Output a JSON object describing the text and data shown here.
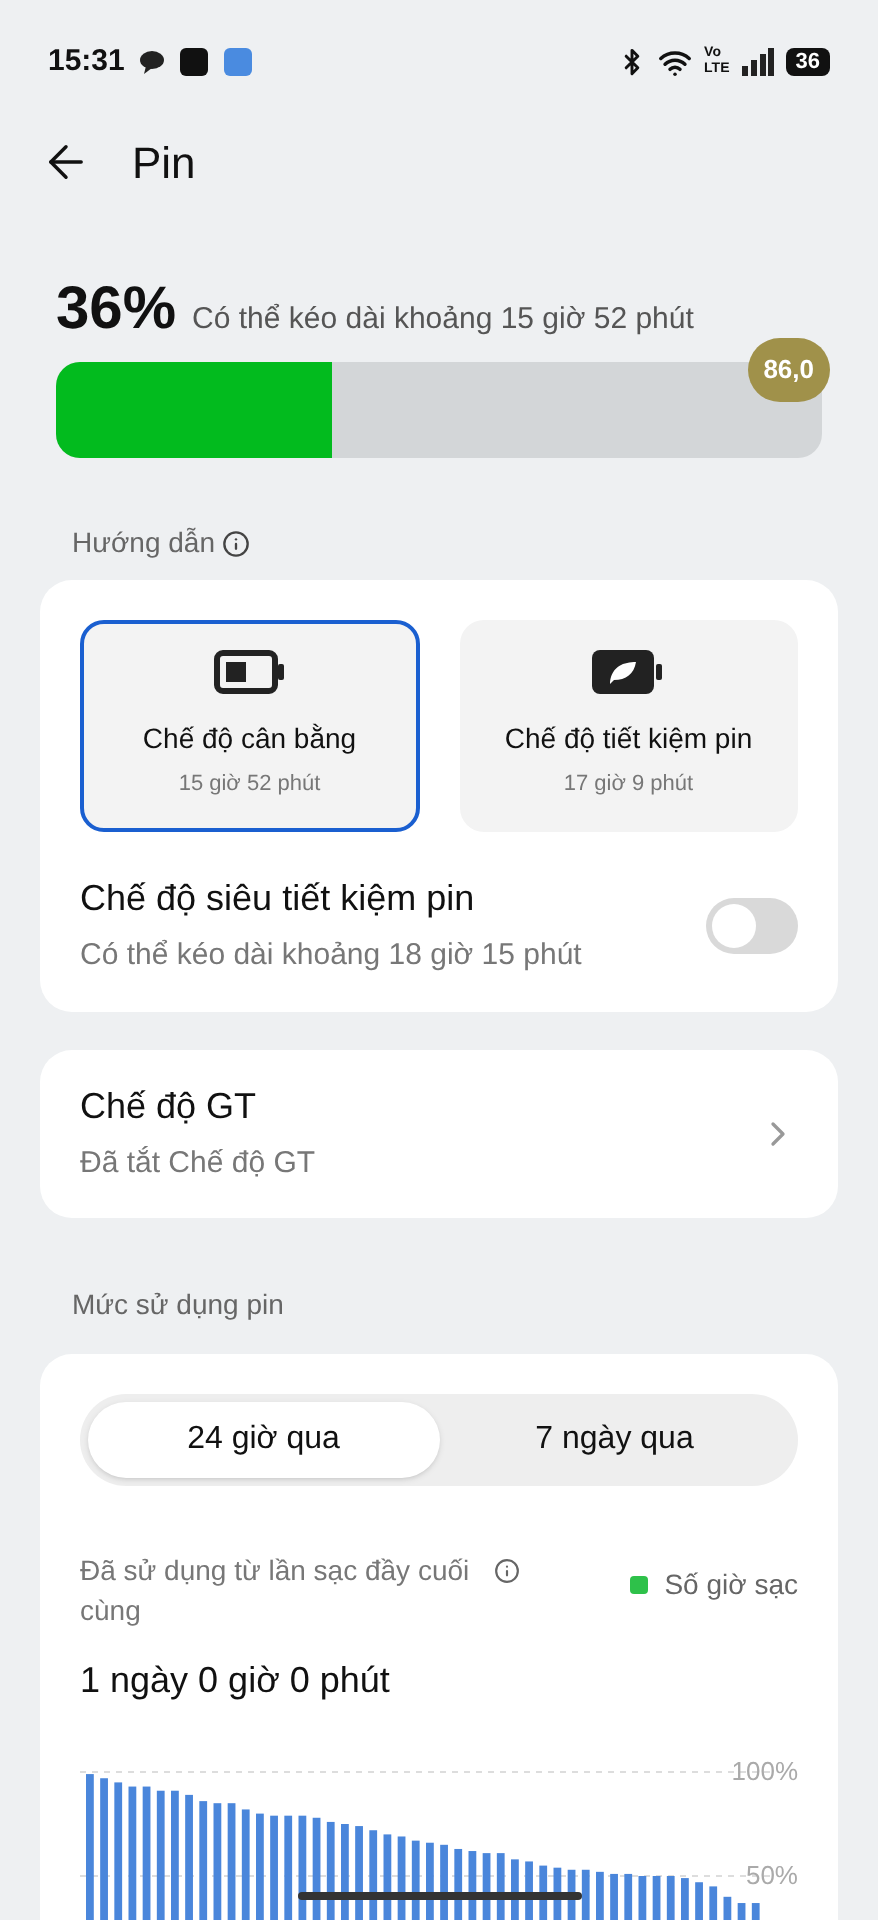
{
  "status_bar": {
    "time": "15:31",
    "volte": [
      "Vo",
      "LTE"
    ],
    "battery": "36"
  },
  "header": {
    "title": "Pin"
  },
  "battery": {
    "percent": "36%",
    "estimate": "Có thể kéo dài khoảng 15 giờ 52 phút",
    "level": 0.36,
    "badge": "86,0"
  },
  "guide": {
    "label": "Hướng dẫn"
  },
  "modes": [
    {
      "kind": "balanced",
      "title": "Chế độ cân bằng",
      "time": "15 giờ 52 phút",
      "selected": true
    },
    {
      "kind": "saver",
      "title": "Chế độ tiết kiệm pin",
      "time": "17 giờ 9 phút",
      "selected": false
    }
  ],
  "super_saver": {
    "title": "Chế độ siêu tiết kiệm pin",
    "subtitle": "Có thể kéo dài khoảng 18 giờ 15 phút",
    "on": false
  },
  "gt_mode": {
    "title": "Chế độ GT",
    "subtitle": "Đã tắt Chế độ GT"
  },
  "usage": {
    "label": "Mức sử dụng pin",
    "tabs": [
      {
        "label": "24 giờ qua",
        "selected": true
      },
      {
        "label": "7 ngày qua",
        "selected": false
      }
    ],
    "since_label": "Đã sử dụng từ lần sạc đầy cuối cùng",
    "legend": {
      "label": "Số giờ sạc",
      "color": "#2ec14a"
    },
    "duration": "1 ngày 0 giờ 0 phút",
    "chart_data": {
      "type": "bar",
      "ylim": [
        0,
        100
      ],
      "yticks": [
        {
          "value": 50,
          "label": "50%"
        },
        {
          "value": 100,
          "label": "100%"
        }
      ],
      "values": [
        99,
        97,
        95,
        93,
        93,
        91,
        91,
        89,
        86,
        85,
        85,
        82,
        80,
        79,
        79,
        79,
        78,
        76,
        75,
        74,
        72,
        70,
        69,
        67,
        66,
        65,
        63,
        62,
        61,
        61,
        58,
        57,
        55,
        54,
        53,
        53,
        52,
        51,
        51,
        50,
        50,
        50,
        49,
        47,
        45,
        40,
        37,
        37
      ]
    }
  }
}
